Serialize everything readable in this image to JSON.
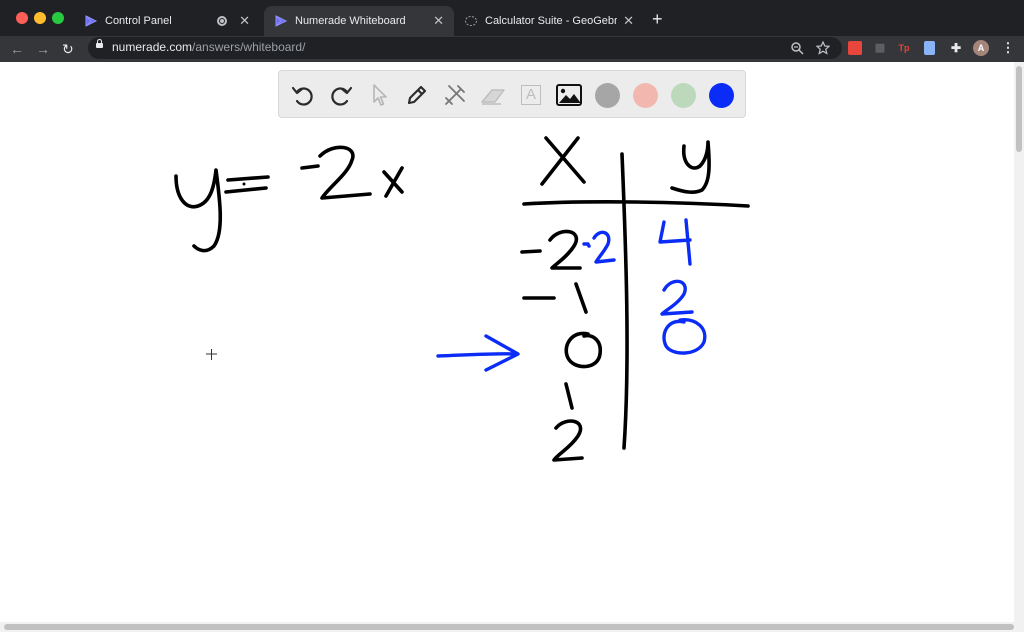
{
  "browser": {
    "tabs": [
      {
        "title": "Control Panel",
        "active": false
      },
      {
        "title": "Numerade Whiteboard",
        "active": true
      },
      {
        "title": "Calculator Suite - GeoGebra",
        "active": false
      }
    ],
    "url_host": "numerade.com",
    "url_path": "/answers/whiteboard/",
    "profile_initial": "A",
    "extension_tp_label": "Tp"
  },
  "whiteboard": {
    "tools": [
      "undo-icon",
      "redo-icon",
      "pointer-icon",
      "pen-icon",
      "shapes-icon",
      "eraser-icon",
      "text-icon",
      "image-icon"
    ],
    "text_tool_label": "A",
    "colors": [
      "#a6a6a6",
      "#f2b8b0",
      "#bcd9bc",
      "#0b2cf6"
    ],
    "selected_color": "#0b2cf6"
  },
  "handwriting": {
    "equation": "y = -2x",
    "table": {
      "headers": [
        "x",
        "y"
      ],
      "x_values": [
        "-2",
        "-1",
        "0",
        "1",
        "2"
      ],
      "y_values": [
        "4",
        "2",
        "0"
      ],
      "annotation": "·-2",
      "arrow_marks_row": "0"
    }
  }
}
